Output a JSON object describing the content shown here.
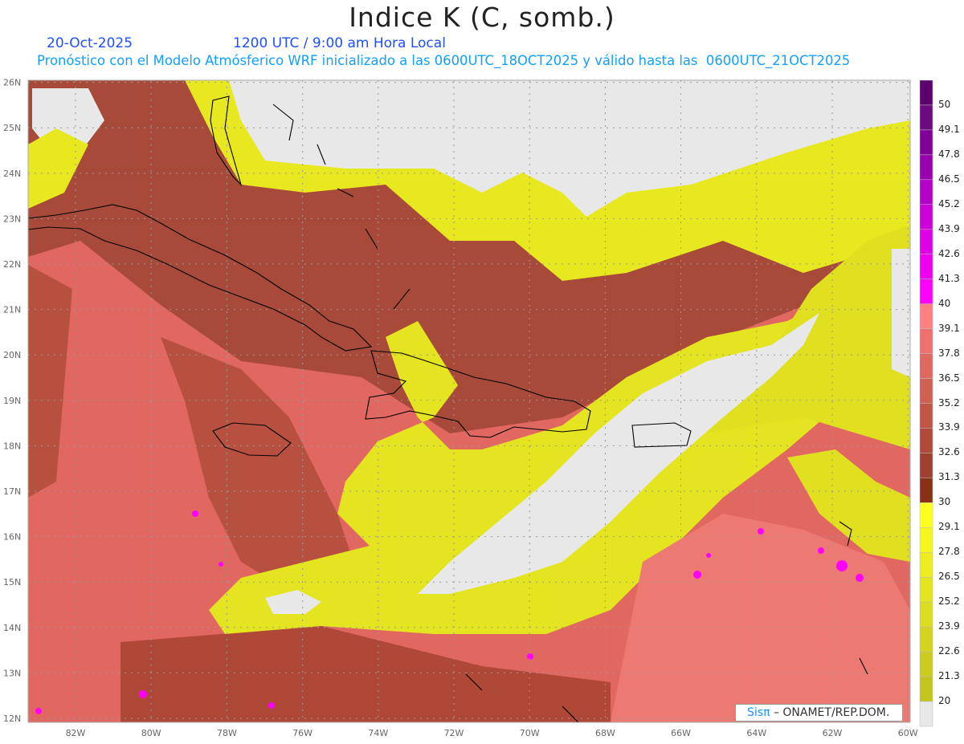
{
  "header": {
    "title": "Indice K (C, somb.)",
    "date": "20-Oct-2025",
    "time": "1200 UTC / 9:00 am Hora Local",
    "subtitle": "Pronóstico con el Modelo Atmósferico WRF inicializado a las 0600UTC_18OCT2025 y válido hasta las  0600UTC_21OCT2025"
  },
  "axes": {
    "lon_labels": [
      "82W",
      "80W",
      "78W",
      "76W",
      "74W",
      "72W",
      "70W",
      "68W",
      "66W",
      "64W",
      "62W",
      "60W"
    ],
    "lat_labels": [
      "12N",
      "13N",
      "14N",
      "15N",
      "16N",
      "17N",
      "18N",
      "19N",
      "20N",
      "21N",
      "22N",
      "23N",
      "24N",
      "25N",
      "26N"
    ]
  },
  "colorbar": {
    "labels": [
      "50",
      "49.1",
      "47.8",
      "46.5",
      "45.2",
      "43.9",
      "42.6",
      "41.3",
      "40",
      "39.1",
      "37.8",
      "36.5",
      "35.2",
      "33.9",
      "32.6",
      "31.3",
      "30",
      "29.1",
      "27.8",
      "26.5",
      "25.2",
      "23.9",
      "22.6",
      "21.3",
      "20"
    ],
    "colors": [
      "#5c0070",
      "#6e0a80",
      "#82009a",
      "#9a00b0",
      "#b400c8",
      "#cc00d8",
      "#e000e8",
      "#f000f0",
      "#ff00ff",
      "#ff8080",
      "#f07070",
      "#e06860",
      "#d06050",
      "#c05545",
      "#b04a3a",
      "#a04030",
      "#8b3018",
      "#ffff20",
      "#f5f520",
      "#ecec20",
      "#e4e420",
      "#dcdc20",
      "#d4d420",
      "#cccc20",
      "#c4c420",
      "#e8e8e8"
    ]
  },
  "credit": {
    "logo": "Sisπ",
    "text": "– ONAMET/REP.DOM."
  }
}
